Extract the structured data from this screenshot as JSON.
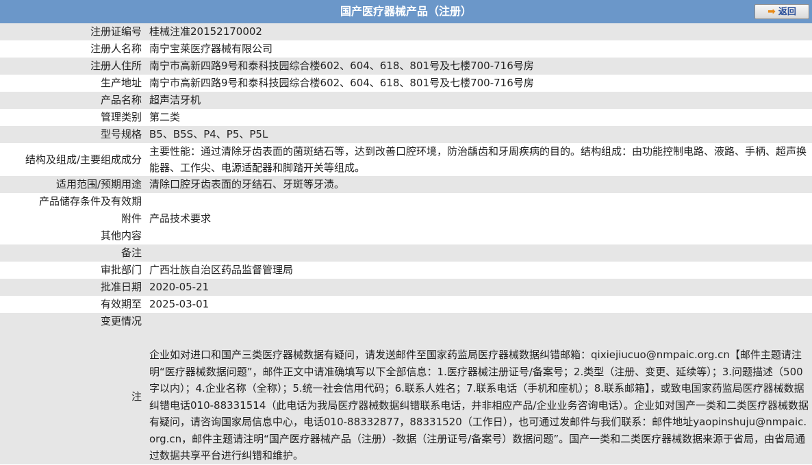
{
  "header": {
    "title": "国产医疗器械产品（注册）",
    "back_label": "返回"
  },
  "rows": [
    {
      "label": "注册证编号",
      "value": "桂械注准20152170002"
    },
    {
      "label": "注册人名称",
      "value": "南宁宝莱医疗器械有限公司"
    },
    {
      "label": "注册人住所",
      "value": "南宁市高新四路9号和泰科技园综合楼602、604、618、801号及七楼700-716号房"
    },
    {
      "label": "生产地址",
      "value": "南宁市高新四路9号和泰科技园综合楼602、604、618、801号及七楼700-716号房"
    },
    {
      "label": "产品名称",
      "value": "超声洁牙机"
    },
    {
      "label": "管理类别",
      "value": "第二类"
    },
    {
      "label": "型号规格",
      "value": "B5、B5S、P4、P5、P5L"
    },
    {
      "label": "结构及组成/主要组成成分",
      "value": "主要性能：通过清除牙齿表面的菌斑结石等，达到改善口腔环境，防治龋齿和牙周疾病的目的。结构组成：由功能控制电路、液路、手柄、超声换能器、工作尖、电源适配器和脚踏开关等组成。"
    },
    {
      "label": "适用范围/预期用途",
      "value": "清除口腔牙齿表面的牙结石、牙斑等牙渍。"
    },
    {
      "label": "产品储存条件及有效期",
      "value": ""
    },
    {
      "label": "附件",
      "value": "产品技术要求"
    },
    {
      "label": "其他内容",
      "value": ""
    },
    {
      "label": "备注",
      "value": ""
    },
    {
      "label": "审批部门",
      "value": "广西壮族自治区药品监督管理局"
    },
    {
      "label": "批准日期",
      "value": "2020-05-21"
    },
    {
      "label": "有效期至",
      "value": "2025-03-01"
    },
    {
      "label": "变更情况",
      "value": ""
    }
  ],
  "note": {
    "label": "注",
    "text": "企业如对进口和国产三类医疗器械数据有疑问，请发送邮件至国家药监局医疗器械数据纠错邮箱：qixiejiucuo@nmpaic.org.cn【邮件主题请注明“医疗器械数据问题”，邮件正文中请准确填写以下全部信息：1.医疗器械注册证号/备案号；2.类型（注册、变更、延续等）；3.问题描述（500字以内）；4.企业名称（全称）；5.统一社会信用代码；6.联系人姓名；7.联系电话（手机和座机）；8.联系邮箱】，或致电国家药监局医疗器械数据纠错电话010-88331514（此电话为我局医疗器械数据纠错联系电话，并非相应产品/企业业务咨询电话）。企业如对国产一类和二类医疗器械数据有疑问，请咨询国家局信息中心，电话010-88332877，88331520（工作日），也可通过发邮件与我们联系：邮件地址yaopinshuju@nmpaic.org.cn，邮件主题请注明“国产医疗器械产品（注册）-数据（注册证号/备案号）数据问题”。国产一类和二类医疗器械数据来源于省局，由省局通过数据共享平台进行纠错和维护。"
  }
}
